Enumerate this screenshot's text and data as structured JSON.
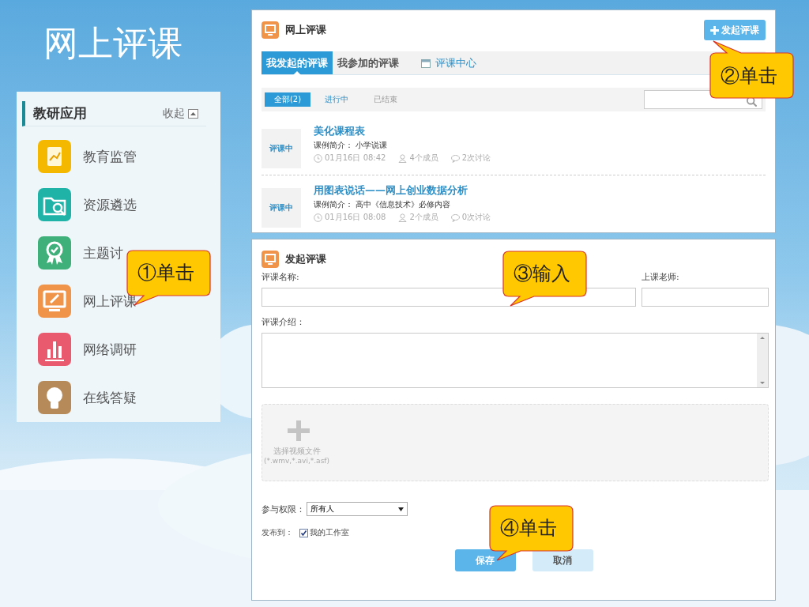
{
  "slide_title": "网上评课",
  "sidebar": {
    "title": "教研应用",
    "collapse": "收起",
    "items": [
      {
        "label": "教育监管",
        "kind": "chart"
      },
      {
        "label": "资源遴选",
        "kind": "folder"
      },
      {
        "label": "主题讨",
        "kind": "badge"
      },
      {
        "label": "网上评课",
        "kind": "monitor"
      },
      {
        "label": "网络调研",
        "kind": "bars"
      },
      {
        "label": "在线答疑",
        "kind": "bulb"
      }
    ]
  },
  "review_panel": {
    "title": "网上评课",
    "new_button": "发起评课",
    "tabs": [
      {
        "label": "我发起的评课",
        "selected": true
      },
      {
        "label": "我参加的评课",
        "selected": false
      },
      {
        "label": "评课中心",
        "selected": false
      }
    ],
    "filters": [
      {
        "label": "全部(2)",
        "selected": true
      },
      {
        "label": "进行中",
        "selected": false
      },
      {
        "label": "已结束",
        "selected": false
      }
    ],
    "items": [
      {
        "status": "评课中",
        "title": "美化课程表",
        "intro_label": "课例简介：",
        "intro": "小学说课",
        "time": "01月16日  08:42",
        "members": "4个成员",
        "discussions": "2次讨论"
      },
      {
        "status": "评课中",
        "title": "用图表说话——网上创业数据分析",
        "intro_label": "课例简介：",
        "intro": "高中《信息技术》必修内容",
        "time": "01月16日  08:08",
        "members": "2个成员",
        "discussions": "0次讨论"
      }
    ]
  },
  "form": {
    "title": "发起评课",
    "name_label": "评课名称:",
    "teacher_label": "上课老师:",
    "intro_label": "评课介绍：",
    "upload": {
      "label": "选择视频文件",
      "formats": "(*.wmv,*.avi,*.asf)"
    },
    "permission_label": "参与权限：",
    "permission_value": "所有人",
    "publish_label": "发布到：",
    "publish_option": {
      "label": "我的工作室",
      "checked": true
    },
    "buttons": [
      {
        "label": "保存",
        "kind": "primary"
      },
      {
        "label": "取消",
        "kind": "secondary"
      }
    ]
  },
  "callouts": [
    {
      "text": "①单击"
    },
    {
      "text": "②单击"
    },
    {
      "text": "③输入"
    },
    {
      "text": "④单击"
    }
  ]
}
